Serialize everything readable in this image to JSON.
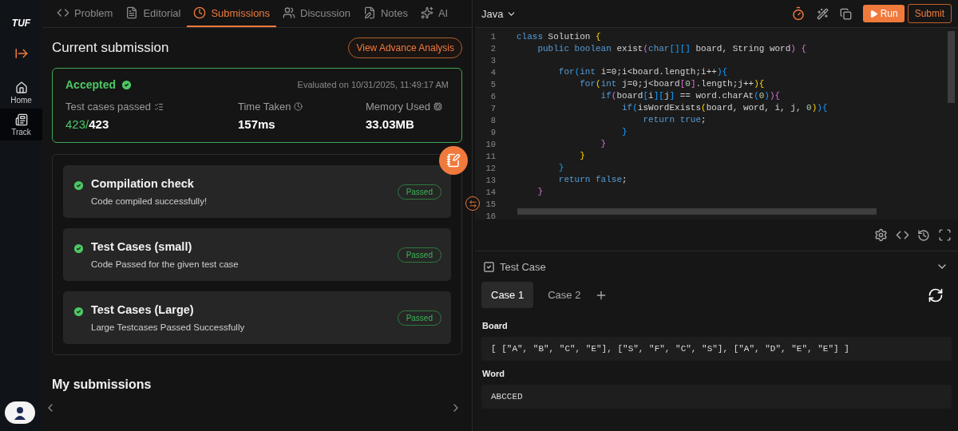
{
  "sidebar": {
    "logo": "TUF",
    "items": [
      {
        "label": "Home",
        "selected": false
      },
      {
        "label": "Track",
        "selected": true
      }
    ]
  },
  "tabs": [
    {
      "label": "Problem",
      "selected": false
    },
    {
      "label": "Editorial",
      "selected": false
    },
    {
      "label": "Submissions",
      "selected": true
    },
    {
      "label": "Discussion",
      "selected": false
    },
    {
      "label": "Notes",
      "selected": false
    },
    {
      "label": "AI",
      "selected": false
    }
  ],
  "current": {
    "title": "Current submission",
    "action": "View Advance Analysis",
    "status": "Accepted",
    "evaluated": "Evaluated on 10/31/2025, 11:49:17 AM",
    "stats": {
      "tests_label": "Test cases passed",
      "tests_passed": "423/",
      "tests_total": "423",
      "time_label": "Time Taken",
      "time_value": "157ms",
      "memory_label": "Memory Used",
      "memory_value": "33.03MB"
    }
  },
  "checks": [
    {
      "title": "Compilation check",
      "detail": "Code compiled successfully!",
      "badge": "Passed",
      "passed": true
    },
    {
      "title": "Test Cases (small)",
      "detail": "Code Passed for the given test case",
      "badge": "Passed",
      "passed": true
    },
    {
      "title": "Test Cases (Large)",
      "detail": "Large Testcases Passed Successfully",
      "badge": "Passed",
      "passed": true
    }
  ],
  "my_submissions": {
    "title": "My submissions"
  },
  "editor": {
    "language": "Java",
    "run": "Run",
    "submit": "Submit",
    "lines": [
      {
        "number": "1",
        "tokens": [
          {
            "t": "class",
            "kind": "keyword"
          },
          {
            "t": " Solution ",
            "kind": "plain"
          },
          {
            "t": "{",
            "kind": "bracket1"
          }
        ]
      },
      {
        "number": "2",
        "tokens": [
          {
            "t": "    public boolean",
            "kind": "keyword"
          },
          {
            "t": " exist",
            "kind": "plain"
          },
          {
            "t": "(",
            "kind": "bracket2"
          },
          {
            "t": "char",
            "kind": "keyword"
          },
          {
            "t": "[][]",
            "kind": "bracket3"
          },
          {
            "t": " board, String word",
            "kind": "plain"
          },
          {
            "t": ") {",
            "kind": "bracket2"
          }
        ]
      },
      {
        "number": "3"
      },
      {
        "number": "4",
        "tokens": [
          {
            "t": "        for",
            "kind": "keyword"
          },
          {
            "t": "(",
            "kind": "bracket3"
          },
          {
            "t": "int",
            "kind": "keyword"
          },
          {
            "t": " i=0;i<board.length;i++",
            "kind": "plain"
          },
          {
            "t": "){",
            "kind": "bracket3"
          }
        ]
      },
      {
        "number": "5",
        "tokens": [
          {
            "t": "            for",
            "kind": "keyword"
          },
          {
            "t": "(",
            "kind": "bracket1"
          },
          {
            "t": "int",
            "kind": "keyword"
          },
          {
            "t": " j=0;j<board",
            "kind": "plain"
          },
          {
            "t": "[",
            "kind": "bracket2"
          },
          {
            "t": "0",
            "kind": "number"
          },
          {
            "t": "]",
            "kind": "bracket2"
          },
          {
            "t": ".length;j++",
            "kind": "plain"
          },
          {
            "t": "){",
            "kind": "bracket1"
          }
        ]
      },
      {
        "number": "6",
        "tokens": [
          {
            "t": "                if",
            "kind": "keyword"
          },
          {
            "t": "(",
            "kind": "bracket2"
          },
          {
            "t": "board",
            "kind": "plain"
          },
          {
            "t": "[",
            "kind": "bracket3"
          },
          {
            "t": "i",
            "kind": "plain"
          },
          {
            "t": "][",
            "kind": "bracket3"
          },
          {
            "t": "j",
            "kind": "plain"
          },
          {
            "t": "]",
            "kind": "bracket3"
          },
          {
            "t": " == word.charAt",
            "kind": "plain"
          },
          {
            "t": "(",
            "kind": "bracket3"
          },
          {
            "t": "0",
            "kind": "number"
          },
          {
            "t": ")",
            "kind": "bracket3"
          },
          {
            "t": "){",
            "kind": "bracket2"
          }
        ]
      },
      {
        "number": "7",
        "tokens": [
          {
            "t": "                    if",
            "kind": "keyword"
          },
          {
            "t": "(",
            "kind": "bracket3"
          },
          {
            "t": "isWordExists",
            "kind": "plain"
          },
          {
            "t": "(",
            "kind": "bracket1"
          },
          {
            "t": "board, word, i, j, ",
            "kind": "plain"
          },
          {
            "t": "0",
            "kind": "number"
          },
          {
            "t": ")",
            "kind": "bracket1"
          },
          {
            "t": "){",
            "kind": "bracket3"
          }
        ]
      },
      {
        "number": "8",
        "tokens": [
          {
            "t": "                        return true",
            "kind": "keyword"
          },
          {
            "t": ";",
            "kind": "plain"
          }
        ]
      },
      {
        "number": "9",
        "tokens": [
          {
            "t": "                    }",
            "kind": "bracket3"
          }
        ]
      },
      {
        "number": "10",
        "tokens": [
          {
            "t": "                }",
            "kind": "bracket2"
          }
        ]
      },
      {
        "number": "11",
        "tokens": [
          {
            "t": "            }",
            "kind": "bracket1"
          }
        ]
      },
      {
        "number": "12",
        "tokens": [
          {
            "t": "        }",
            "kind": "bracket3"
          }
        ]
      },
      {
        "number": "13",
        "tokens": [
          {
            "t": "        return false",
            "kind": "keyword"
          },
          {
            "t": ";",
            "kind": "plain"
          }
        ]
      },
      {
        "number": "14",
        "tokens": [
          {
            "t": "    }",
            "kind": "bracket2"
          }
        ]
      },
      {
        "number": "15"
      },
      {
        "number": "16"
      }
    ]
  },
  "testcase": {
    "title": "Test Case",
    "cases": [
      {
        "label": "Case 1",
        "selected": true
      },
      {
        "label": "Case 2",
        "selected": false
      }
    ],
    "fields": [
      {
        "label": "Board",
        "value": "[ [\"A\", \"B\", \"C\", \"E\"], [\"S\", \"F\", \"C\", \"S\"], [\"A\", \"D\", \"E\", \"E\"] ]"
      },
      {
        "label": "Word",
        "value": "ABCCED"
      }
    ]
  }
}
